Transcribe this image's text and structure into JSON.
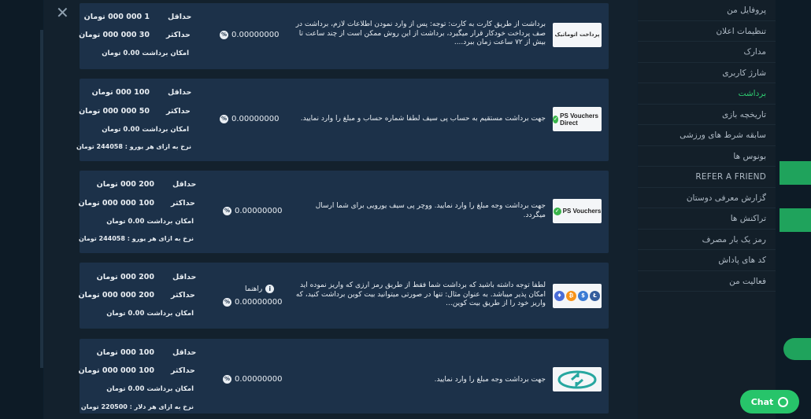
{
  "sidebar": {
    "items": [
      {
        "label": "پروفایل من",
        "active": false
      },
      {
        "label": "تنظیمات اعلان",
        "active": false
      },
      {
        "label": "مدارک",
        "active": false
      },
      {
        "label": "شارژ کاربری",
        "active": false
      },
      {
        "label": "برداشت",
        "active": true
      },
      {
        "label": "تاریخچه بازی",
        "active": false
      },
      {
        "label": "سابقه شرط های ورزشی",
        "active": false
      },
      {
        "label": "بونوس ها",
        "active": false
      },
      {
        "label": "REFER A FRIEND",
        "active": false
      },
      {
        "label": "گزارش معرفی دوستان",
        "active": false
      },
      {
        "label": "تراکنش ها",
        "active": false
      },
      {
        "label": "رمز یک بار مصرف",
        "active": false
      },
      {
        "label": "کد های پاداش",
        "active": false
      },
      {
        "label": "فعالیت من",
        "active": false
      }
    ]
  },
  "modal": {
    "close_icon": "close-icon",
    "labels": {
      "min": "حداقل",
      "max": "حداکثر"
    },
    "methods": [
      {
        "logo": "پرداخت اتوماتیک",
        "description": "برداشت از طریق کارت به کارت: توجه: پس از وارد نمودن اطلاعات لازم، برداشت در صف پرداخت خودکار قرار میگیرد، برداشت از این روش ممکن است از چند ساعت تا بیش از ۷۲ ساعت زمان ببرد....",
        "percent": "0.00000000",
        "min": "1 000 000 تومان",
        "max": "30 000 000 تومان",
        "possible": "امکان برداشت 0.00 تومان"
      },
      {
        "logo": "PS Vouchers Direct",
        "description": "جهت برداشت مستقیم به حساب پی سیف لطفا شماره حساب و مبلغ را وارد نمایید.",
        "percent": "0.00000000",
        "min": "100 000 تومان",
        "max": "50 000 000 تومان",
        "possible": "امکان برداشت 0.00 تومان",
        "rate": "نرخ به ازای هر یورو : 244058 تومان"
      },
      {
        "logo": "PS Vouchers",
        "description": "جهت برداشت وجه مبلغ را وارد نمایید. ووچر پی سیف یورویی برای شما ارسال میگردد.",
        "percent": "0.00000000",
        "min": "200 000 تومان",
        "max": "100 000 000 تومان",
        "possible": "امکان برداشت 0.00 تومان",
        "rate": "نرخ به ازای هر یورو : 244058 تومان"
      },
      {
        "logo": "crypto",
        "description": "لطفا توجه داشته باشید که برداشت شما فقط از طریق رمز ارزی که واریز نموده اید امکان پذیر میباشد. به عنوان مثال: تنها در صورتی میتوانید بیت کوین برداشت کنید، که واریز خود را از طریق بیت کوین...",
        "guide": "راهنما",
        "percent": "0.00000000",
        "min": "200 000 تومان",
        "max": "200 000 000 تومان",
        "possible": "امکان برداشت 0.00 تومان"
      },
      {
        "logo": "tether",
        "description": "جهت برداشت وجه مبلغ را وارد نمایید.",
        "percent": "0.00000000",
        "min": "100 000 تومان",
        "max": "100 000 000 تومان",
        "possible": "امکان برداشت 0.00 تومان",
        "rate": "نرخ به ازای هر دلار : 220500 تومان"
      }
    ]
  },
  "chat": {
    "label": "Chat"
  },
  "colors": {
    "card_bg": "#1c3149",
    "active_menu": "#2ecc71",
    "chat_bg": "#27c46a"
  }
}
